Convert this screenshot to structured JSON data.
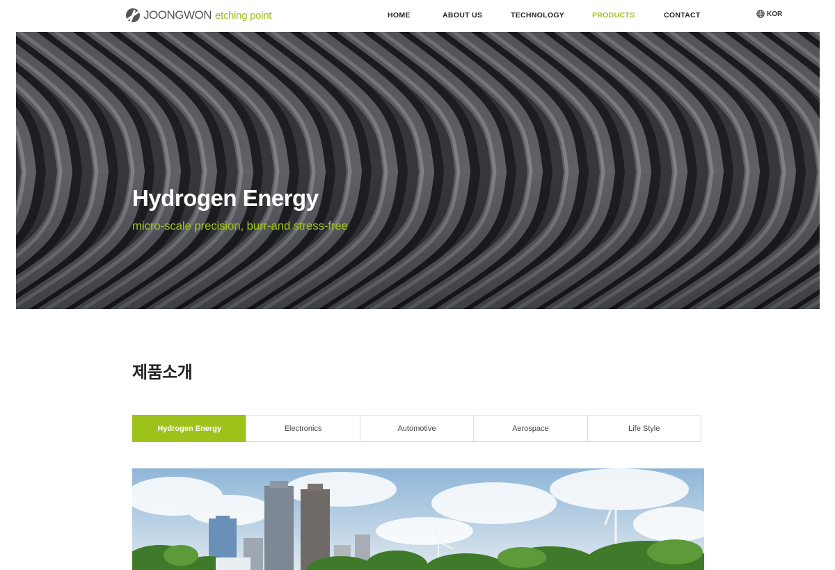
{
  "header": {
    "logo_main": "JOONGWON",
    "logo_sub": "etching point",
    "nav": [
      {
        "label": "HOME",
        "active": false
      },
      {
        "label": "ABOUT US",
        "active": false
      },
      {
        "label": "TECHNOLOGY",
        "active": false
      },
      {
        "label": "PRODUCTS",
        "active": true
      },
      {
        "label": "CONTACT",
        "active": false
      }
    ],
    "lang_label": "KOR",
    "lang_icon": "globe-icon"
  },
  "hero": {
    "title": "Hydrogen Energy",
    "subtitle": "micro-scale precision, burr-and stress-free"
  },
  "section": {
    "title": "제품소개",
    "tabs": [
      {
        "label": "Hydrogen Energy",
        "active": true
      },
      {
        "label": "Electronics",
        "active": false
      },
      {
        "label": "Automotive",
        "active": false
      },
      {
        "label": "Aerospace",
        "active": false
      },
      {
        "label": "Life Style",
        "active": false
      }
    ]
  },
  "colors": {
    "accent": "#9dc31a",
    "text": "#222222",
    "border": "#dcdcdc"
  }
}
